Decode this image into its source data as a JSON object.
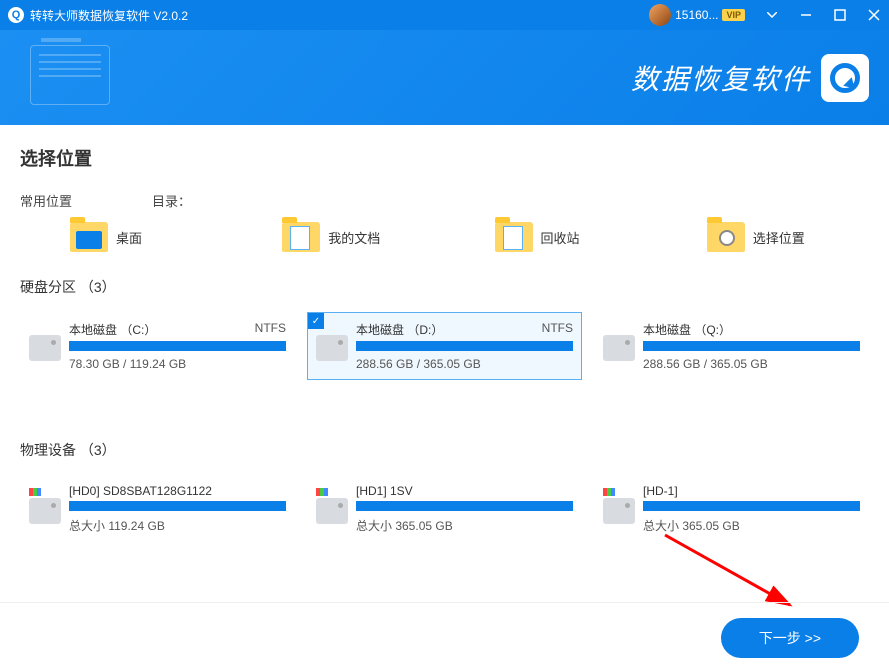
{
  "titlebar": {
    "app_title": "转转大师数据恢复软件 V2.0.2",
    "user_id": "15160...",
    "vip_label": "VIP"
  },
  "banner": {
    "brand_text": "数据恢复软件"
  },
  "sections": {
    "choose_location": "选择位置",
    "common_header_left": "常用位置",
    "common_header_right": "目录：",
    "partitions_header": "硬盘分区 （3）",
    "devices_header": "物理设备 （3）"
  },
  "common_locations": [
    {
      "label": "桌面",
      "icon": "desktop"
    },
    {
      "label": "我的文档",
      "icon": "docs"
    },
    {
      "label": "回收站",
      "icon": "recycle"
    },
    {
      "label": "选择位置",
      "icon": "browse"
    }
  ],
  "partitions": [
    {
      "name": "本地磁盘 （C:）",
      "fs": "NTFS",
      "size": "78.30 GB / 119.24 GB",
      "selected": false
    },
    {
      "name": "本地磁盘 （D:）",
      "fs": "NTFS",
      "size": "288.56 GB / 365.05 GB",
      "selected": true
    },
    {
      "name": "本地磁盘 （Q:）",
      "fs": "",
      "size": "288.56 GB / 365.05 GB",
      "selected": false
    }
  ],
  "devices": [
    {
      "name": "[HD0] SD8SBAT128G1122",
      "size": "总大小 119.24 GB"
    },
    {
      "name": "[HD1] 1SV",
      "size": "总大小 365.05 GB"
    },
    {
      "name": "[HD-1]",
      "size": "总大小 365.05 GB"
    }
  ],
  "footer": {
    "next_label": "下一步 >>"
  }
}
